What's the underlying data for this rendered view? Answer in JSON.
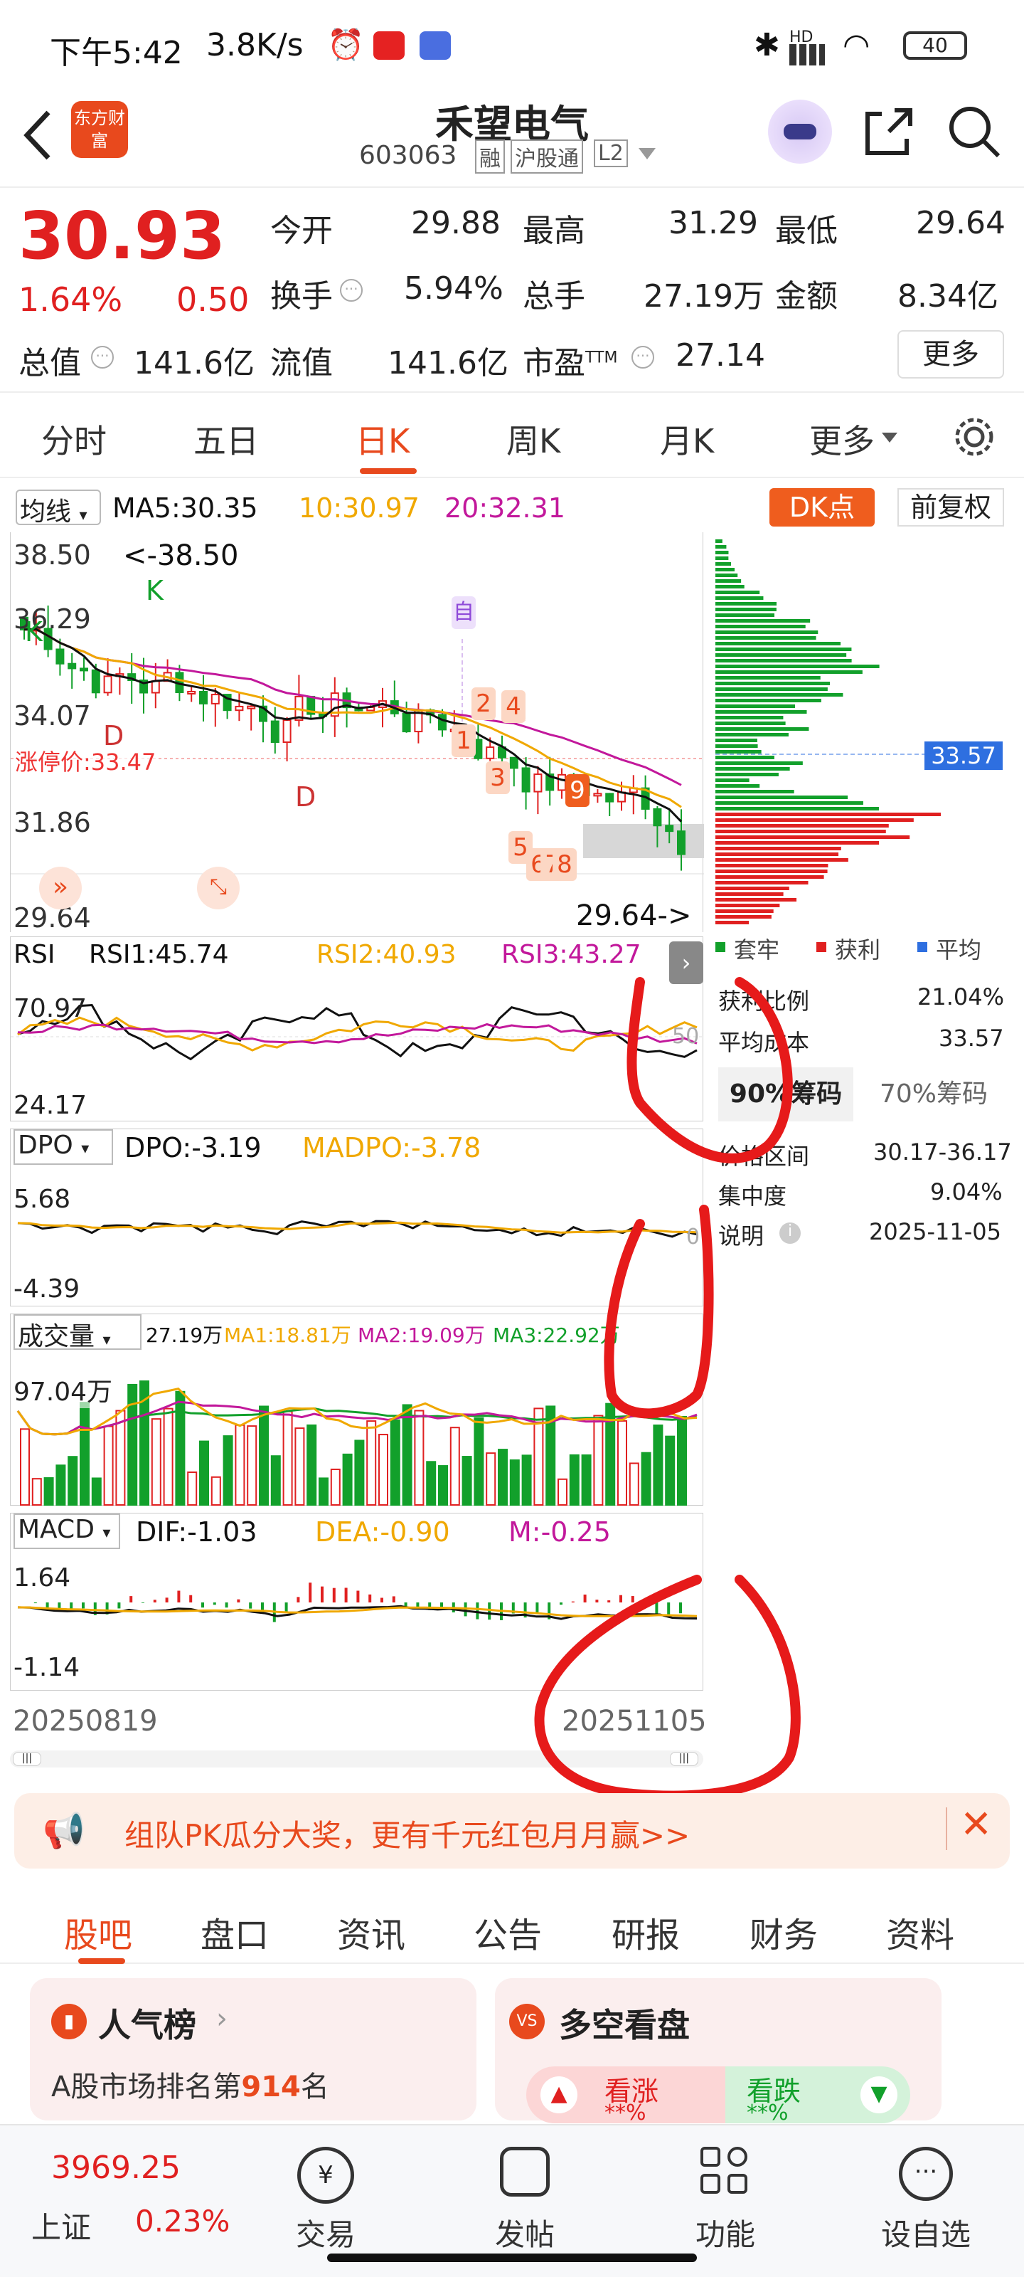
{
  "status": {
    "time": "下午5:42",
    "speed": "3.8K/s",
    "battery": "40",
    "signal": "HD"
  },
  "header": {
    "title": "禾望电气",
    "code": "603063",
    "tags": [
      "融",
      "沪股通",
      "L2"
    ],
    "logo": "东方财富"
  },
  "quote": {
    "price": "30.93",
    "change_pct": "1.64%",
    "change": "0.50",
    "rows": [
      [
        {
          "k": "今开",
          "v": "29.88",
          "c": "green"
        },
        {
          "k": "最高",
          "v": "31.29",
          "c": "red"
        },
        {
          "k": "最低",
          "v": "29.64",
          "c": "green"
        }
      ],
      [
        {
          "k": "换手",
          "v": "5.94%",
          "c": "dark"
        },
        {
          "k": "总手",
          "v": "27.19万",
          "c": "dark"
        },
        {
          "k": "金额",
          "v": "8.34亿",
          "c": "dark"
        }
      ],
      [
        {
          "k": "总值",
          "v": "141.6亿",
          "c": "dark"
        },
        {
          "k": "流值",
          "v": "141.6亿",
          "c": "dark"
        },
        {
          "k": "市盈TTM",
          "v": "27.14",
          "c": "dark"
        }
      ]
    ],
    "more": "更多"
  },
  "tabs": [
    "分时",
    "五日",
    "日K",
    "周K",
    "月K",
    "更多"
  ],
  "active_tab": "日K",
  "ma_line": {
    "selector": "均线",
    "ma5": "MA5:30.35",
    "ma10": "10:30.97",
    "ma20": "20:32.31",
    "dk": "DK点",
    "fq": "前复权"
  },
  "kline": {
    "y_labels": [
      "38.50",
      "36.29",
      "34.07",
      "31.86",
      "29.64"
    ],
    "high_mark": "<-38.50",
    "low_mark": "29.64->",
    "limit_label": "涨停价:33.47",
    "marker": "自",
    "k": "K",
    "d": "D"
  },
  "chips": {
    "avg_badge": "33.57",
    "legend": [
      "套牢",
      "获利",
      "平均"
    ],
    "profit_ratio_k": "获利比例",
    "profit_ratio_v": "21.04%",
    "avg_cost_k": "平均成本",
    "avg_cost_v": "33.57",
    "chip90": "90%筹码",
    "chip70": "70%筹码",
    "range_k": "价格区间",
    "range_v": "30.17-36.17",
    "conc_k": "集中度",
    "conc_v": "9.04%",
    "note_k": "说明",
    "note_v": "2025-11-05"
  },
  "rsi": {
    "name": "RSI",
    "r1": "RSI1:45.74",
    "r2": "RSI2:40.93",
    "r3": "RSI3:43.27",
    "top": "70.97",
    "bottom": "24.17",
    "mid": "50"
  },
  "dpo": {
    "name": "DPO",
    "v": "DPO:-3.19",
    "mad": "MADPO:-3.78",
    "top": "5.68",
    "bottom": "-4.39",
    "zero": "0"
  },
  "vol": {
    "name": "成交量",
    "v": "27.19万",
    "ma1": "MA1:18.81万",
    "ma2": "MA2:19.09万",
    "ma3": "MA3:22.92万",
    "top": "97.04万"
  },
  "macd": {
    "name": "MACD",
    "dif": "DIF:-1.03",
    "dea": "DEA:-0.90",
    "m": "M:-0.25",
    "top": "1.64",
    "bottom": "-1.14",
    "date_start": "20250819",
    "date_end": "20251105"
  },
  "banner": "组队PK瓜分大奖，更有千元红包月月赢>>",
  "bottom_tabs": [
    "股吧",
    "盘口",
    "资讯",
    "公告",
    "研报",
    "财务",
    "资料"
  ],
  "cards": {
    "left_title": "人气榜",
    "left_text_pre": "A股市场排名第",
    "left_rank": "914",
    "left_text_post": "名",
    "right_title": "多空看盘",
    "up": "看涨",
    "down": "看跌",
    "up_pct": "**%",
    "down_pct": "**%"
  },
  "dock": {
    "index_value": "3969.25",
    "index_name": "上证",
    "index_pct": "0.23%",
    "items": [
      "交易",
      "发帖",
      "功能",
      "设自选"
    ]
  },
  "colors": {
    "up": "#e02020",
    "down": "#12a02b",
    "accent": "#e8491d",
    "ma10": "#f0a800",
    "ma20": "#c2189b"
  }
}
